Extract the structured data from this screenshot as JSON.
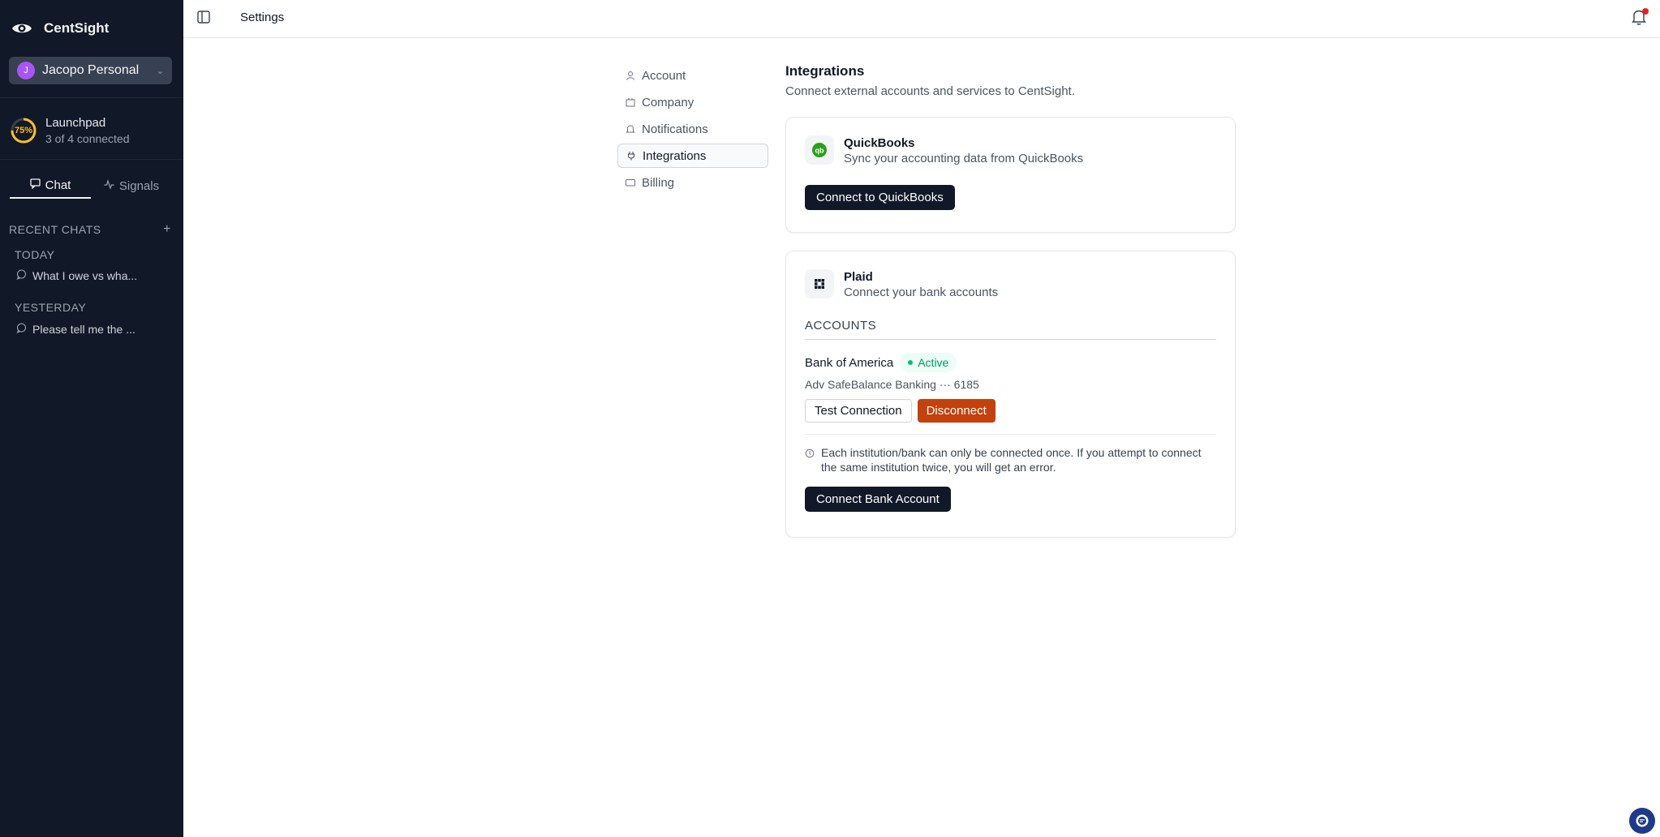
{
  "app": {
    "name": "CentSight",
    "page_title": "Settings"
  },
  "sidebar": {
    "workspace": {
      "avatar": "J",
      "name": "Jacopo Personal"
    },
    "launchpad": {
      "percent": "75%",
      "progress": 0.75,
      "title": "Launchpad",
      "subtitle": "3 of 4 connected"
    },
    "tabs": [
      {
        "label": "Chat",
        "icon": "chat-icon"
      },
      {
        "label": "Signals",
        "icon": "activity-icon"
      }
    ],
    "recent_chats_label": "RECENT CHATS",
    "groups": [
      {
        "label": "TODAY",
        "chats": [
          "What I owe vs wha..."
        ]
      },
      {
        "label": "YESTERDAY",
        "chats": [
          "Please tell me the ..."
        ]
      }
    ]
  },
  "settings_nav": [
    {
      "label": "Account",
      "icon": "user-icon"
    },
    {
      "label": "Company",
      "icon": "building-icon"
    },
    {
      "label": "Notifications",
      "icon": "bell-icon"
    },
    {
      "label": "Integrations",
      "icon": "plug-icon",
      "active": true
    },
    {
      "label": "Billing",
      "icon": "card-icon"
    }
  ],
  "integrations": {
    "title": "Integrations",
    "subtitle": "Connect external accounts and services to CentSight.",
    "quickbooks": {
      "name": "QuickBooks",
      "logo_text": "qb",
      "description": "Sync your accounting data from QuickBooks",
      "connect_label": "Connect to QuickBooks"
    },
    "plaid": {
      "name": "Plaid",
      "description": "Connect your bank accounts",
      "accounts_label": "ACCOUNTS",
      "bank": {
        "name": "Bank of America",
        "status": "Active",
        "account_line": "Adv SafeBalance Banking ··· 6185",
        "test_label": "Test Connection",
        "disconnect_label": "Disconnect"
      },
      "note": "Each institution/bank can only be connected once. If you attempt to connect the same institution twice, you will get an error.",
      "connect_label": "Connect Bank Account"
    }
  },
  "colors": {
    "sidebar_bg": "#111827",
    "primary_button": "#111827",
    "danger": "#c2410c",
    "active_green": "#059669",
    "launchpad_ring": "#fbbf24"
  }
}
